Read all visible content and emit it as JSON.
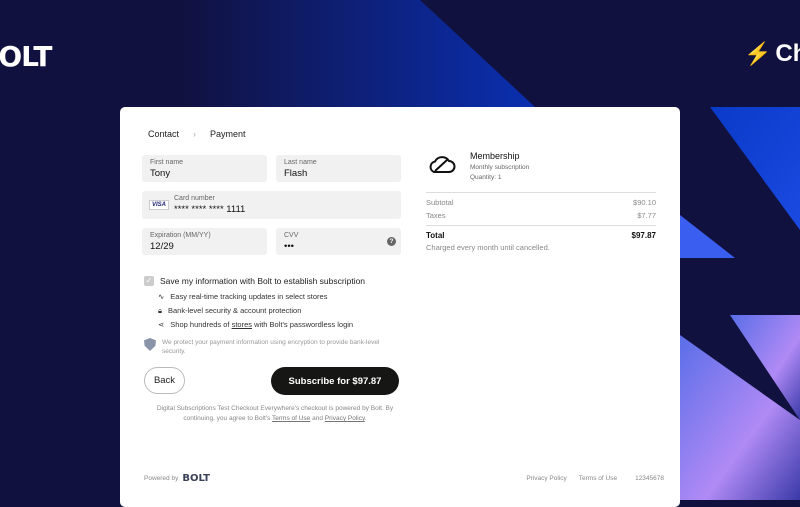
{
  "brand": {
    "left_logo": "BOLT",
    "right_logo": "Ch",
    "colors": {
      "bg": "#11113f",
      "accent": "#2ad0f5"
    }
  },
  "breadcrumb": {
    "step1": "Contact",
    "step2": "Payment"
  },
  "form": {
    "first_name": {
      "label": "First name",
      "value": "Tony"
    },
    "last_name": {
      "label": "Last name",
      "value": "Flash"
    },
    "card": {
      "label": "Card number",
      "value": "**** **** **** 1111",
      "brand": "VISA"
    },
    "expiry": {
      "label": "Expiration (MM/YY)",
      "value": "12/29"
    },
    "cvv": {
      "label": "CVV",
      "value": "•••",
      "help": "?"
    }
  },
  "save": {
    "label": "Save my information with Bolt to establish subscription",
    "checked": true,
    "features": [
      "Easy real-time tracking updates in select stores",
      "Bank-level security & account protection"
    ],
    "feature3_pre": "Shop hundreds of ",
    "feature3_link": "stores",
    "feature3_post": " with Bolt's passwordless login"
  },
  "secure_text": "We protect your payment information using encryption to provide bank-level security.",
  "buttons": {
    "back": "Back",
    "subscribe": "Subscribe for $97.87"
  },
  "legal": {
    "pre": "Digital Subscriptions Test Checkout Everywhere's checkout is powered by Bolt. By continuing, you agree to Bolt's ",
    "terms": "Terms of Use",
    "and": " and ",
    "privacy": "Privacy Policy",
    "end": "."
  },
  "summary": {
    "product": "Membership",
    "subtitle": "Monthly subscription",
    "quantity": "Quantity: 1",
    "subtotal_label": "Subtotal",
    "subtotal": "$90.10",
    "taxes_label": "Taxes",
    "taxes": "$7.77",
    "total_label": "Total",
    "total": "$97.87",
    "charged": "Charged every month until cancelled."
  },
  "footer": {
    "powered": "Powered by",
    "logo": "BOLT",
    "privacy": "Privacy Policy",
    "terms": "Terms of Use",
    "id": "12345678"
  }
}
